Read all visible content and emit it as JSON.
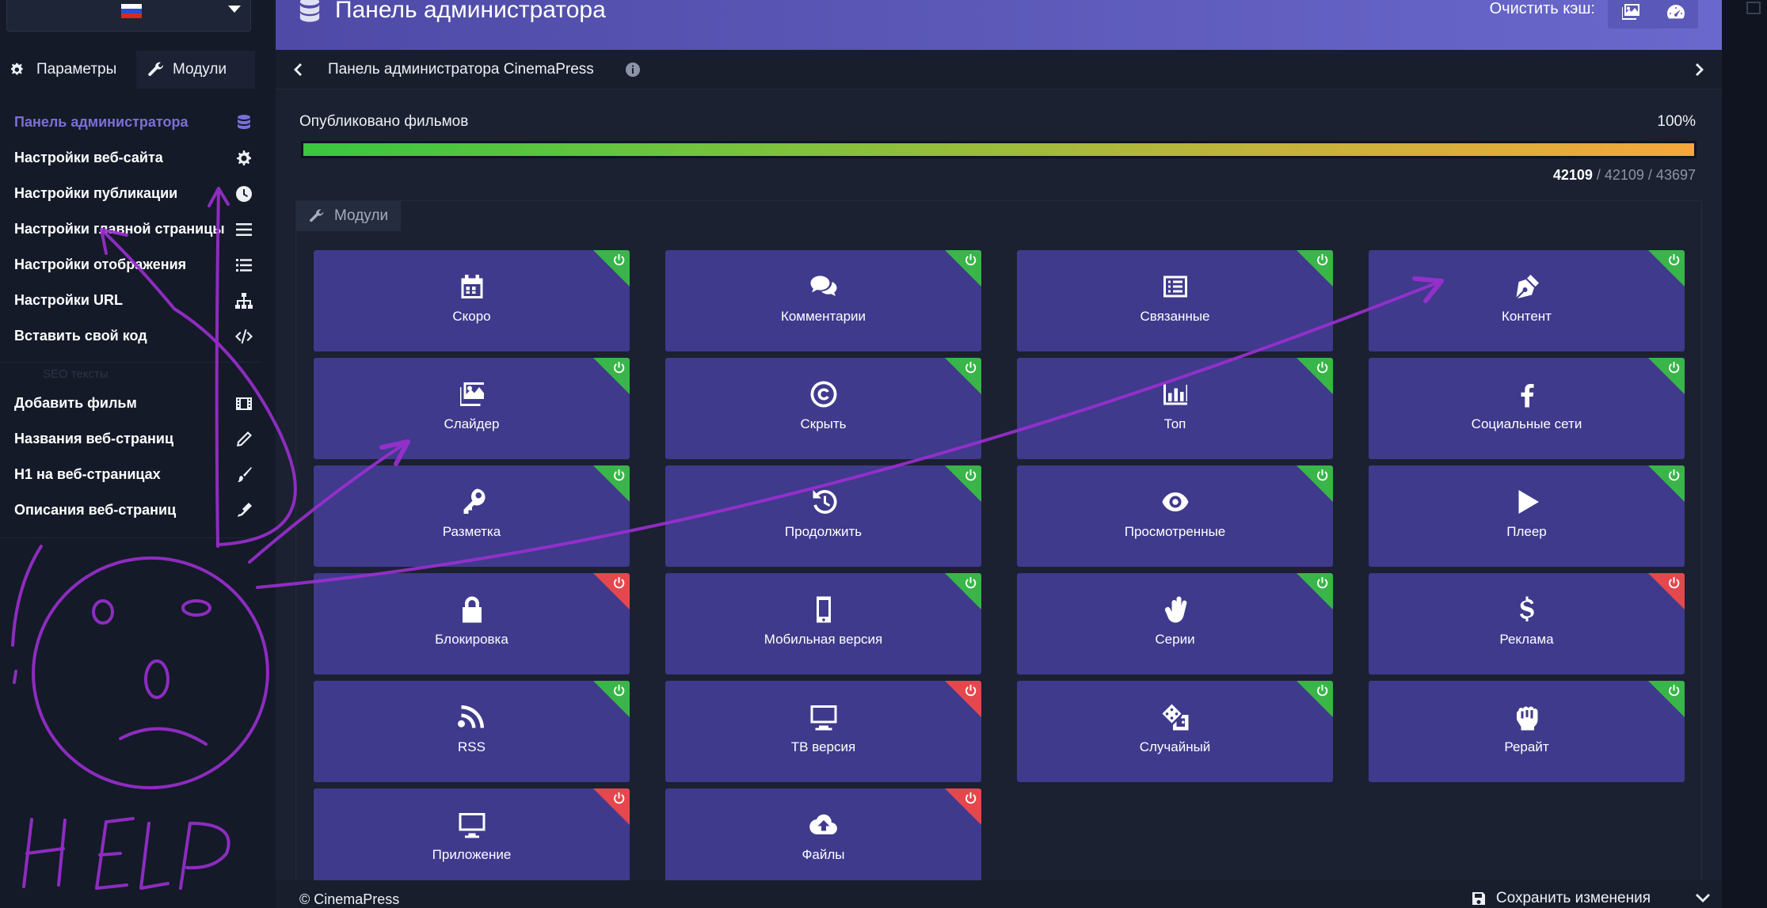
{
  "header": {
    "title": "Панель администратора",
    "cache_label": "Очистить кэш:"
  },
  "sidebar": {
    "tabs": [
      {
        "label": "Параметры",
        "icon": "gears-icon"
      },
      {
        "label": "Модули",
        "icon": "wrench-icon"
      }
    ],
    "items": [
      {
        "label": "Панель администратора",
        "icon": "database-icon",
        "active": true
      },
      {
        "label": "Настройки веб-сайта",
        "icon": "gear-icon"
      },
      {
        "label": "Настройки публикации",
        "icon": "clock-icon"
      },
      {
        "label": "Настройки главной страницы",
        "icon": "bars-icon"
      },
      {
        "label": "Настройки отображения",
        "icon": "list-icon"
      },
      {
        "label": "Настройки URL",
        "icon": "sitemap-icon"
      },
      {
        "label": "Вставить свой код",
        "icon": "code-icon"
      }
    ],
    "section_label": "SEO тексты",
    "seo_items": [
      {
        "label": "Добавить фильм",
        "icon": "film-icon"
      },
      {
        "label": "Названия веб-страниц",
        "icon": "pencil-icon"
      },
      {
        "label": "H1 на веб-страницах",
        "icon": "brush-icon"
      },
      {
        "label": "Описания веб-страниц",
        "icon": "pen-icon"
      }
    ]
  },
  "breadcrumb": {
    "text": "Панель администратора CinemaPress"
  },
  "publication": {
    "label": "Опубликовано фильмов",
    "percent_text": "100%",
    "progress": 1.0,
    "count_bold": "42109",
    "count_rest": " / 42109 / 43697"
  },
  "modules": {
    "tab_label": "Модули",
    "cards": [
      {
        "label": "Скоро",
        "icon": "calendar-icon",
        "enabled": true
      },
      {
        "label": "Комментарии",
        "icon": "comments-icon",
        "enabled": true
      },
      {
        "label": "Связанные",
        "icon": "list-alt-icon",
        "enabled": true
      },
      {
        "label": "Контент",
        "icon": "pen-nib-icon",
        "enabled": true
      },
      {
        "label": "Слайдер",
        "icon": "images-icon",
        "enabled": true
      },
      {
        "label": "Скрыть",
        "icon": "copyright-icon",
        "enabled": true
      },
      {
        "label": "Топ",
        "icon": "chart-bar-icon",
        "enabled": true
      },
      {
        "label": "Социальные сети",
        "icon": "facebook-icon",
        "enabled": true
      },
      {
        "label": "Разметка",
        "icon": "key-icon",
        "enabled": true
      },
      {
        "label": "Продолжить",
        "icon": "history-icon",
        "enabled": true
      },
      {
        "label": "Просмотренные",
        "icon": "eye-icon",
        "enabled": true
      },
      {
        "label": "Плеер",
        "icon": "play-icon",
        "enabled": true
      },
      {
        "label": "Блокировка",
        "icon": "lock-icon",
        "enabled": false
      },
      {
        "label": "Мобильная версия",
        "icon": "mobile-icon",
        "enabled": true
      },
      {
        "label": "Серии",
        "icon": "hand-spock-icon",
        "enabled": true
      },
      {
        "label": "Реклама",
        "icon": "dollar-icon",
        "enabled": false
      },
      {
        "label": "RSS",
        "icon": "rss-icon",
        "enabled": true
      },
      {
        "label": "ТВ версия",
        "icon": "tv-icon",
        "enabled": false
      },
      {
        "label": "Случайный",
        "icon": "dice-icon",
        "enabled": true
      },
      {
        "label": "Рерайт",
        "icon": "hand-rock-icon",
        "enabled": true
      },
      {
        "label": "Приложение",
        "icon": "desktop-icon",
        "enabled": false
      },
      {
        "label": "Файлы",
        "icon": "cloud-upload-icon",
        "enabled": false
      }
    ]
  },
  "footer": {
    "copyright": "© CinemaPress",
    "save_label": "Сохранить изменения"
  },
  "colors": {
    "accent": "#7c6fd6",
    "card_bg": "#3f3a8c",
    "enabled": "#39b54a",
    "disabled": "#e4484f"
  },
  "annotation": {
    "handwritten_text": "HELP"
  }
}
